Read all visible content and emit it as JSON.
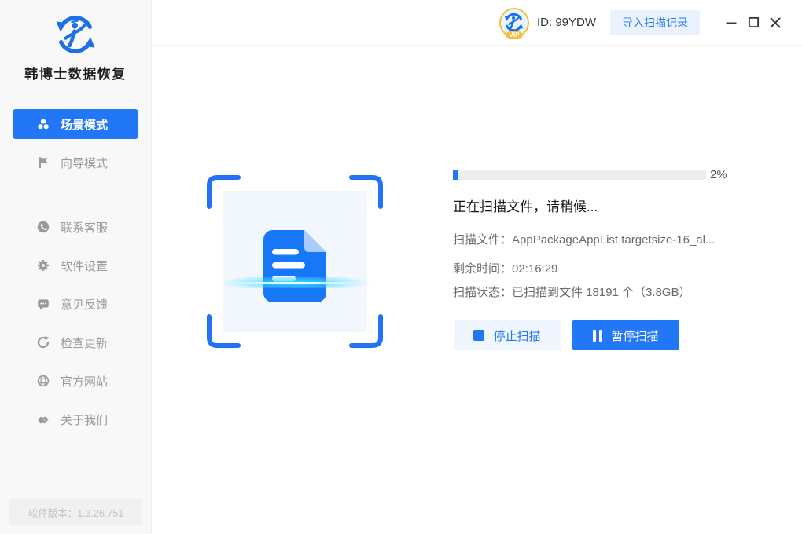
{
  "app": {
    "title": "韩博士数据恢复",
    "version_text": "软件版本：1.3.26.751"
  },
  "header": {
    "vip_badge": "VIP",
    "user_id": "ID: 99YDW",
    "import_button": "导入扫描记录"
  },
  "sidebar": {
    "items": [
      {
        "label": "场景模式",
        "icon": "scenes-icon",
        "active": true
      },
      {
        "label": "向导模式",
        "icon": "flag-icon",
        "active": false
      },
      {
        "label": "联系客服",
        "icon": "phone-icon",
        "active": false
      },
      {
        "label": "软件设置",
        "icon": "gear-icon",
        "active": false
      },
      {
        "label": "意见反馈",
        "icon": "feedback-icon",
        "active": false
      },
      {
        "label": "检查更新",
        "icon": "update-icon",
        "active": false
      },
      {
        "label": "官方网站",
        "icon": "globe-icon",
        "active": false
      },
      {
        "label": "关于我们",
        "icon": "handshake-icon",
        "active": false
      }
    ]
  },
  "scan": {
    "progress_percent": 2,
    "progress_label": "2%",
    "status_title": "正在扫描文件，请稍候...",
    "file_line": "扫描文件：AppPackageAppList.targetsize-16_al...",
    "time_line": "剩余时间：02:16:29",
    "state_line": "扫描状态：已扫描到文件 18191 个（3.8GB）",
    "stop_button": "停止扫描",
    "pause_button": "暂停扫描"
  },
  "icons": {
    "logo": "circular-arrows-with-person",
    "scanner": "document-being-scanned",
    "stop": "blue-square",
    "pause": "double-bars",
    "minimize": "—",
    "maximize": "□",
    "close": "✕"
  },
  "colors": {
    "accent": "#2177F6",
    "accent_light_bg": "#EAF3FD",
    "sidebar_bg": "#F8F8F8",
    "scan_area_bg": "#F2F7FD",
    "scan_line": "#40E0FF",
    "vip_gold": "#F5BD3D"
  }
}
